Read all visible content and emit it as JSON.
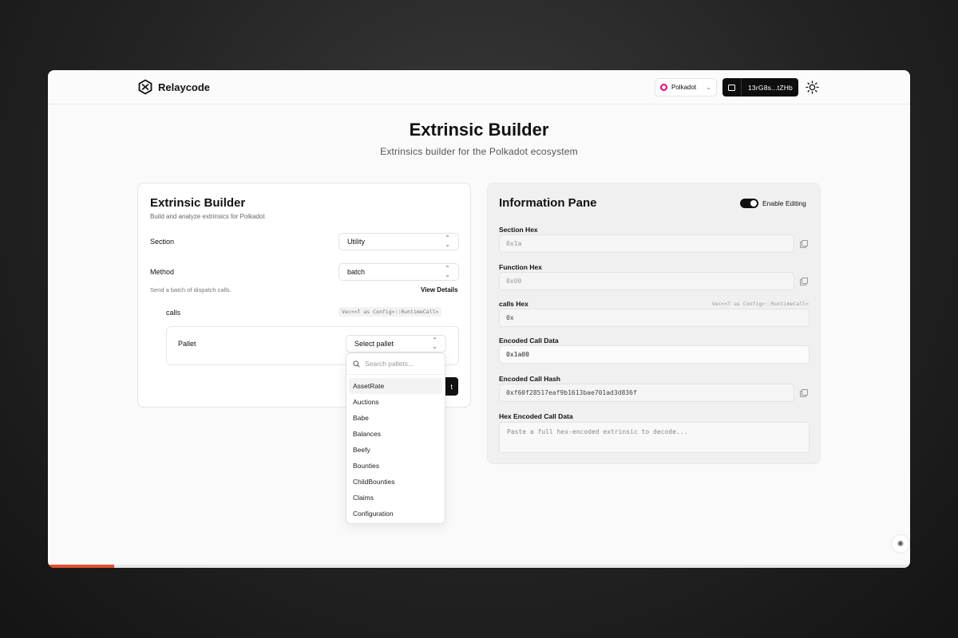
{
  "header": {
    "brand": "Relaycode",
    "network": "Polkadot",
    "account": "13rG8s...tZHb"
  },
  "hero": {
    "title": "Extrinsic Builder",
    "subtitle": "Extrinsics builder for the Polkadot ecosystem"
  },
  "builder": {
    "title": "Extrinsic Builder",
    "description": "Build and analyze extrinsics for Polkadot",
    "section_label": "Section",
    "section_value": "Utility",
    "method_label": "Method",
    "method_value": "batch",
    "method_hint": "Send a batch of dispatch calls.",
    "view_details": "View Details",
    "calls_label": "calls",
    "calls_type": "Vec<<T as Config>::RuntimeCall>",
    "pallet_label": "Pallet",
    "pallet_placeholder": "Select pallet",
    "submit_label": "t"
  },
  "dropdown": {
    "search_placeholder": "Search pallets...",
    "items": [
      "AssetRate",
      "Auctions",
      "Babe",
      "Balances",
      "Beefy",
      "Bounties",
      "ChildBounties",
      "Claims",
      "Configuration"
    ]
  },
  "info": {
    "title": "Information Pane",
    "toggle_label": "Enable Editing",
    "editing_enabled": true,
    "section_hex_label": "Section Hex",
    "section_hex_value": "0x1a",
    "function_hex_label": "Function Hex",
    "function_hex_value": "0x00",
    "calls_hex_label": "calls Hex",
    "calls_hex_type": "Vec<<T as Config>::RuntimeCall>",
    "calls_hex_value": "0x",
    "encoded_call_label": "Encoded Call Data",
    "encoded_call_value": "0x1a00",
    "encoded_hash_label": "Encoded Call Hash",
    "encoded_hash_value": "0xf60f28517eaf9b1613bae701ad3d836f",
    "hex_encoded_label": "Hex Encoded Call Data",
    "hex_encoded_placeholder": "Paste a full hex-encoded extrinsic to decode..."
  },
  "page_progress": 0.077,
  "colors": {
    "accent": "#111111",
    "polkadot": "#e6007a",
    "progress": "#e2502e"
  }
}
